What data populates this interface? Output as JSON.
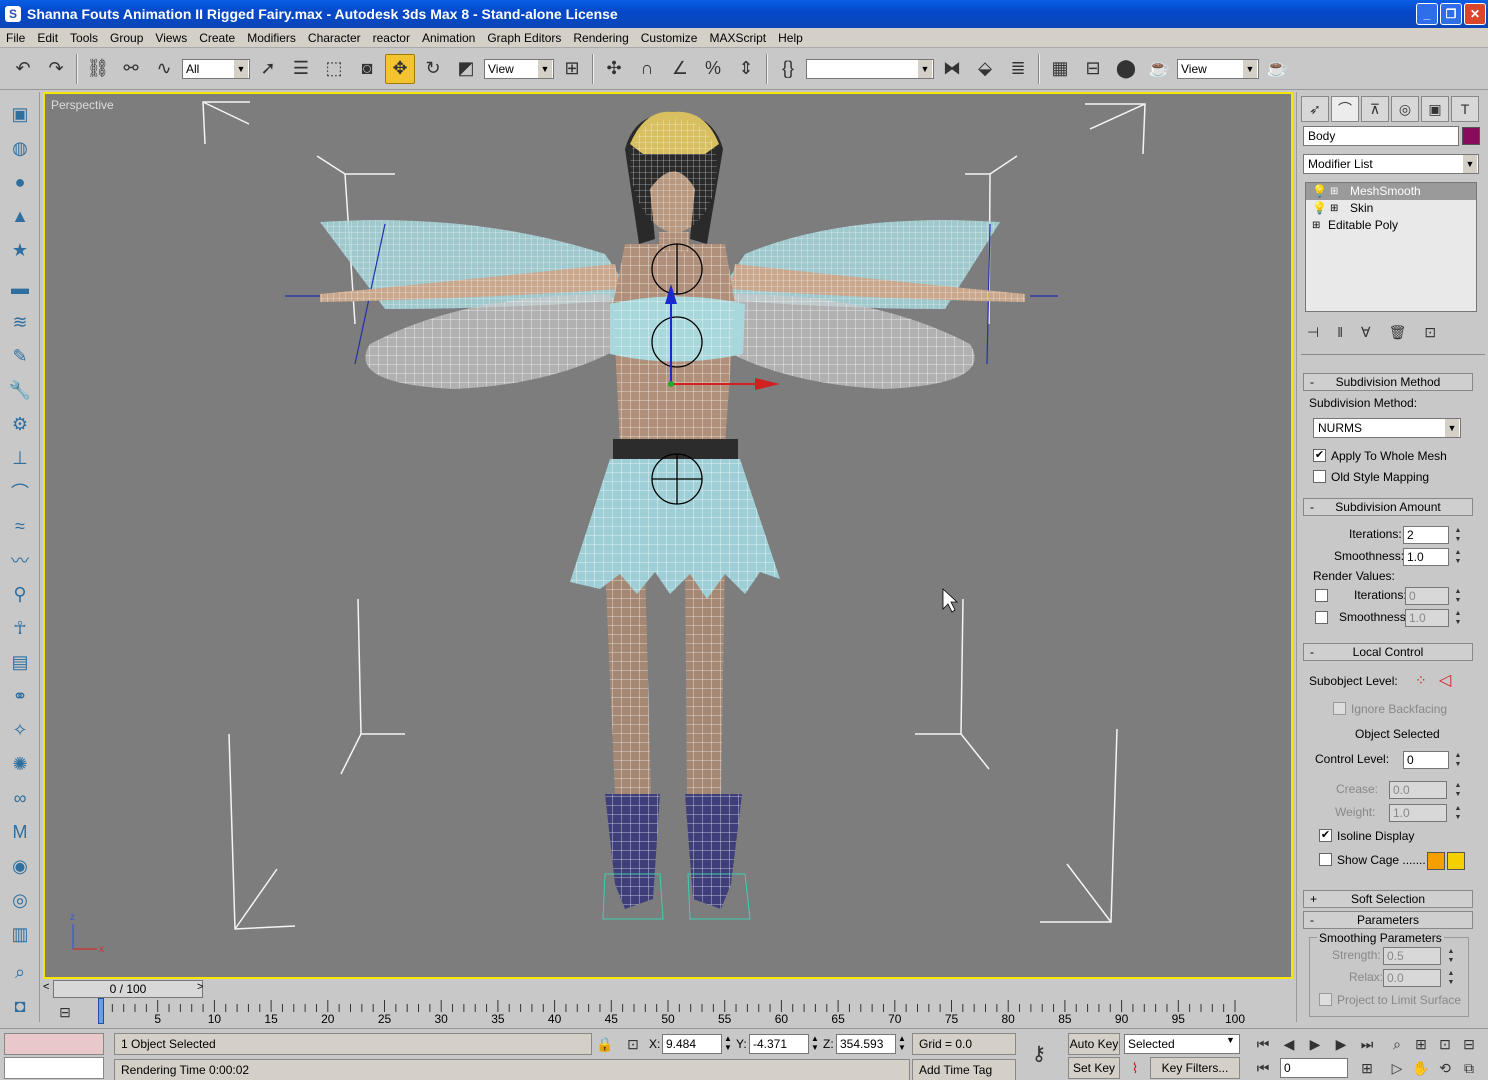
{
  "window": {
    "title": "Shanna Fouts Animation II Rigged Fairy.max  - Autodesk 3ds Max 8  - Stand-alone License"
  },
  "menu": [
    "File",
    "Edit",
    "Tools",
    "Group",
    "Views",
    "Create",
    "Modifiers",
    "Character",
    "reactor",
    "Animation",
    "Graph Editors",
    "Rendering",
    "Customize",
    "MAXScript",
    "Help"
  ],
  "toolbar": {
    "selection_filter": "All",
    "ref_coord_1": "View",
    "named_selection": "",
    "ref_coord_2": "View"
  },
  "viewport": {
    "label": "Perspective",
    "axes": {
      "z": "z",
      "x": "x"
    }
  },
  "command_panel": {
    "object_name": "Body",
    "object_color": "#8a0a5c",
    "modifier_list": "Modifier List",
    "stack": [
      {
        "label": "MeshSmooth",
        "selected": true
      },
      {
        "label": "Skin",
        "selected": false
      },
      {
        "label": "Editable Poly",
        "selected": false
      }
    ],
    "subdivision_method": {
      "title": "Subdivision Method",
      "method_label": "Subdivision Method:",
      "method": "NURMS",
      "apply_whole_mesh": "Apply To Whole Mesh",
      "apply_whole_mesh_checked": true,
      "old_style": "Old Style Mapping",
      "old_style_checked": false
    },
    "subdivision_amount": {
      "title": "Subdivision Amount",
      "iterations_label": "Iterations:",
      "iterations": "2",
      "smoothness_label": "Smoothness:",
      "smoothness": "1.0",
      "render_values": "Render Values:",
      "render_iterations_label": "Iterations:",
      "render_iterations": "0",
      "render_smoothness_label": "Smoothness:",
      "render_smoothness": "1.0"
    },
    "local_control": {
      "title": "Local Control",
      "subobject_label": "Subobject Level:",
      "ignore_backfacing": "Ignore Backfacing",
      "object_selected": "Object Selected",
      "control_level_label": "Control Level:",
      "control_level": "0",
      "crease_label": "Crease:",
      "crease": "0.0",
      "weight_label": "Weight:",
      "weight": "1.0",
      "isoline": "Isoline Display",
      "isoline_checked": true,
      "show_cage": "Show Cage .......",
      "cage_color_1": "#f5a000",
      "cage_color_2": "#f5d000"
    },
    "soft_selection": {
      "title": "Soft Selection",
      "sign": "+"
    },
    "parameters": {
      "title": "Parameters",
      "sign": "-",
      "smoothing_params": "Smoothing Parameters",
      "strength_label": "Strength:",
      "strength": "0.5",
      "relax_label": "Relax:",
      "relax": "0.0",
      "project": "Project to Limit Surface"
    }
  },
  "timeline": {
    "slider": "0 / 100",
    "ticks": [
      "0",
      "5",
      "10",
      "15",
      "20",
      "25",
      "30",
      "35",
      "40",
      "45",
      "50",
      "55",
      "60",
      "65",
      "70",
      "75",
      "80",
      "85",
      "90",
      "95",
      "100"
    ]
  },
  "status": {
    "selection": "1 Object Selected",
    "rendering_time": "Rendering Time  0:00:02",
    "x_label": "X:",
    "x": "9.484",
    "y_label": "Y:",
    "y": "-4.371",
    "z_label": "Z:",
    "z": "354.593",
    "grid": "Grid = 0.0",
    "add_time_tag": "Add Time Tag",
    "auto_key": "Auto Key",
    "selected": "Selected",
    "set_key": "Set Key",
    "key_filters": "Key Filters...",
    "frame": "0"
  }
}
